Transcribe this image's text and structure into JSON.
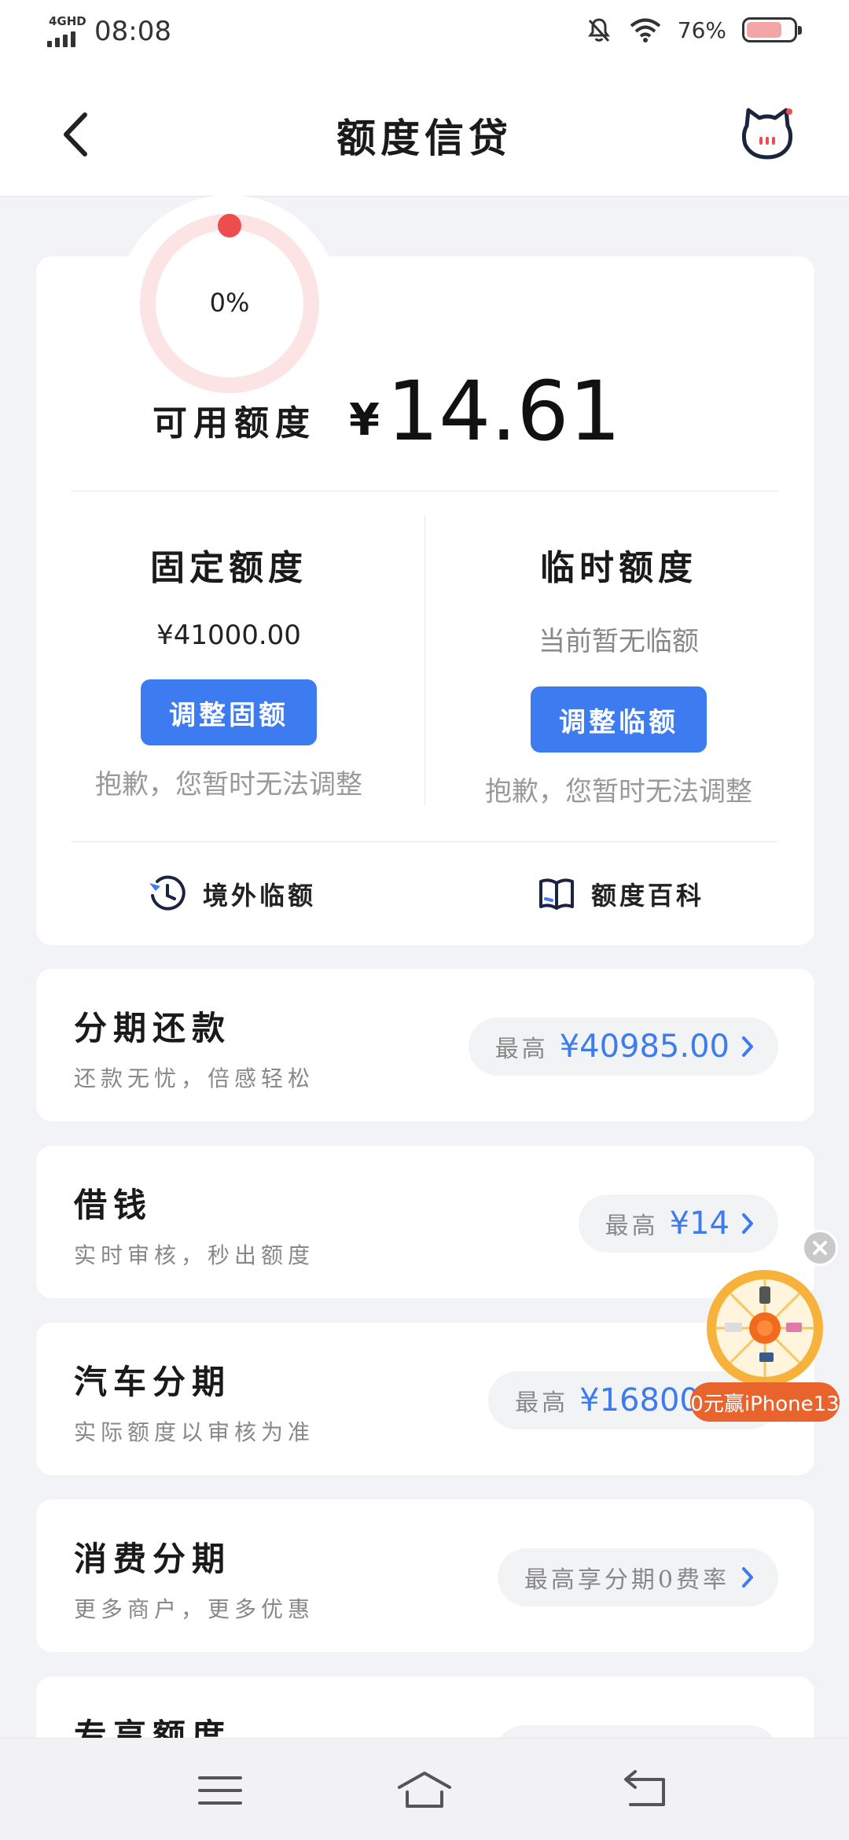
{
  "status_bar": {
    "network": "4GHD",
    "time": "08:08",
    "battery_percent": "76%",
    "battery_level": 0.76,
    "icons": [
      "mute-bell-icon",
      "wifi-icon",
      "battery-icon"
    ]
  },
  "header": {
    "title": "额度信贷",
    "icons": [
      "back-arrow-icon",
      "mascot-icon"
    ]
  },
  "credit": {
    "usage_percent": "0%",
    "available_label": "可用额度",
    "currency": "¥",
    "available_amount": "14.61",
    "fixed": {
      "title": "固定额度",
      "value": "¥41000.00",
      "button": "调整固额",
      "note": "抱歉，您暂时无法调整"
    },
    "temporary": {
      "title": "临时额度",
      "value": "当前暂无临额",
      "button": "调整临额",
      "note": "抱歉，您暂时无法调整"
    },
    "links": [
      {
        "label": "境外临额",
        "icon": "plane-clock-icon"
      },
      {
        "label": "额度百科",
        "icon": "book-icon"
      }
    ]
  },
  "products": [
    {
      "title": "分期还款",
      "subtitle": "还款无忧，倍感轻松",
      "pill_label": "最高",
      "pill_amount": "¥40985.00"
    },
    {
      "title": "借钱",
      "subtitle": "实时审核，秒出额度",
      "pill_label": "最高",
      "pill_amount": "¥14"
    },
    {
      "title": "汽车分期",
      "subtitle": "实际额度以审核为准",
      "pill_label": "最高",
      "pill_amount": "¥168000."
    },
    {
      "title": "消费分期",
      "subtitle": "更多商户，更多优惠",
      "pill_label": "最高享分期0费率",
      "pill_amount": ""
    },
    {
      "title": "专享额度",
      "subtitle": "",
      "pill_label": "",
      "pill_amount": ""
    }
  ],
  "promo": {
    "label": "0元赢iPhone13",
    "icons": [
      "prize-wheel-icon",
      "close-icon"
    ]
  },
  "nav": {
    "icons": [
      "menu-icon",
      "home-icon",
      "back-icon"
    ]
  },
  "colors": {
    "accent_blue": "#3d7bf0",
    "ring_red": "#ee4d4d",
    "ring_track": "#fde4e4",
    "promo_orange": "#e8642c",
    "page_bg": "#f2f3f7"
  }
}
